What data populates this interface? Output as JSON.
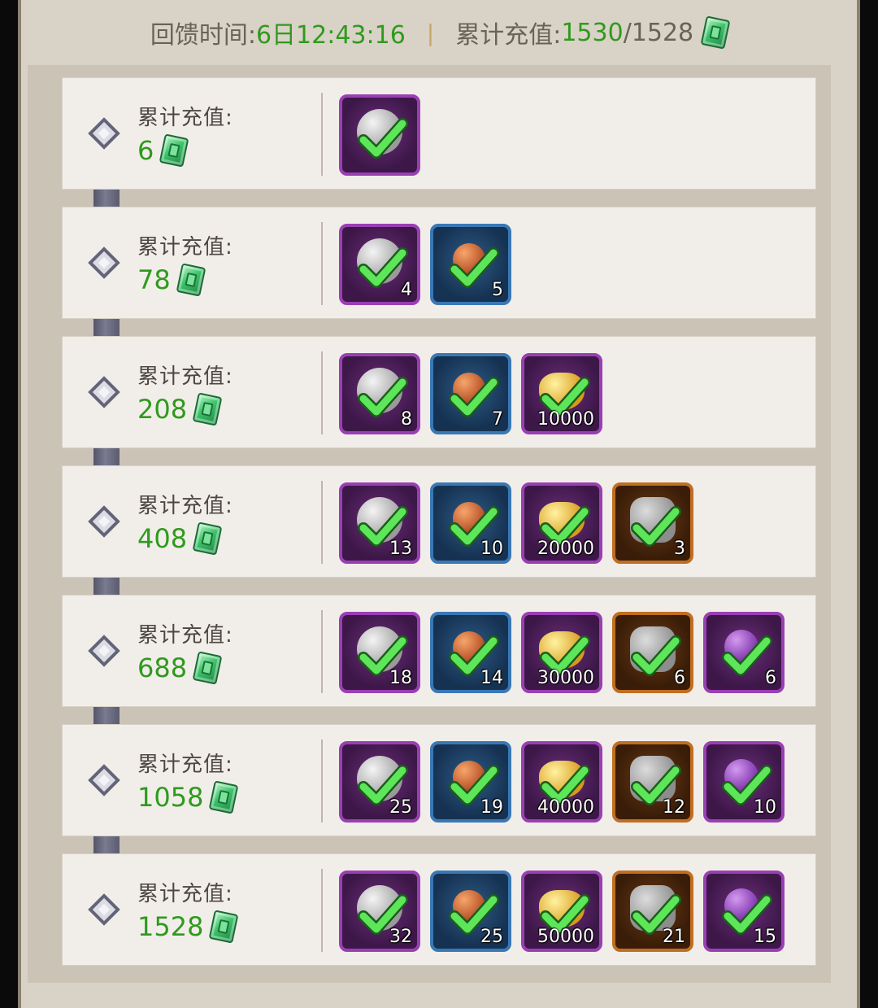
{
  "header": {
    "time_label": "回馈时间:",
    "time_value": "6日12:43:16",
    "recharge_label": "累计充值:",
    "recharge_current": "1530",
    "recharge_target": "/1528",
    "currency_icon": "jade-gem-icon"
  },
  "tiers": [
    {
      "label": "累计充值:",
      "amount": "6",
      "items": [
        {
          "type": "silver-coin",
          "frame": "purple",
          "qty": ""
        }
      ]
    },
    {
      "label": "累计充值:",
      "amount": "78",
      "items": [
        {
          "type": "silver-coin",
          "frame": "purple",
          "qty": "4"
        },
        {
          "type": "copper-orb",
          "frame": "blue",
          "qty": "5"
        }
      ]
    },
    {
      "label": "累计充值:",
      "amount": "208",
      "items": [
        {
          "type": "silver-coin",
          "frame": "purple",
          "qty": "8"
        },
        {
          "type": "copper-orb",
          "frame": "blue",
          "qty": "7"
        },
        {
          "type": "gold-ingot",
          "frame": "purple",
          "qty": "10000"
        }
      ]
    },
    {
      "label": "累计充值:",
      "amount": "408",
      "items": [
        {
          "type": "silver-coin",
          "frame": "purple",
          "qty": "13"
        },
        {
          "type": "copper-orb",
          "frame": "blue",
          "qty": "10"
        },
        {
          "type": "gold-ingot",
          "frame": "purple",
          "qty": "20000"
        },
        {
          "type": "ore",
          "frame": "orange",
          "qty": "3"
        }
      ]
    },
    {
      "label": "累计充值:",
      "amount": "688",
      "items": [
        {
          "type": "silver-coin",
          "frame": "purple",
          "qty": "18"
        },
        {
          "type": "copper-orb",
          "frame": "blue",
          "qty": "14"
        },
        {
          "type": "gold-ingot",
          "frame": "purple",
          "qty": "30000"
        },
        {
          "type": "ore",
          "frame": "orange",
          "qty": "6"
        },
        {
          "type": "purple-gem",
          "frame": "purple",
          "qty": "6"
        }
      ]
    },
    {
      "label": "累计充值:",
      "amount": "1058",
      "items": [
        {
          "type": "silver-coin",
          "frame": "purple",
          "qty": "25"
        },
        {
          "type": "copper-orb",
          "frame": "blue",
          "qty": "19"
        },
        {
          "type": "gold-ingot",
          "frame": "purple",
          "qty": "40000"
        },
        {
          "type": "ore",
          "frame": "orange",
          "qty": "12"
        },
        {
          "type": "purple-gem",
          "frame": "purple",
          "qty": "10"
        }
      ]
    },
    {
      "label": "累计充值:",
      "amount": "1528",
      "items": [
        {
          "type": "silver-coin",
          "frame": "purple",
          "qty": "32"
        },
        {
          "type": "copper-orb",
          "frame": "blue",
          "qty": "25"
        },
        {
          "type": "gold-ingot",
          "frame": "purple",
          "qty": "50000"
        },
        {
          "type": "ore",
          "frame": "orange",
          "qty": "21"
        },
        {
          "type": "purple-gem",
          "frame": "purple",
          "qty": "15"
        }
      ]
    }
  ],
  "claimed_icon": "green-checkmark-icon"
}
